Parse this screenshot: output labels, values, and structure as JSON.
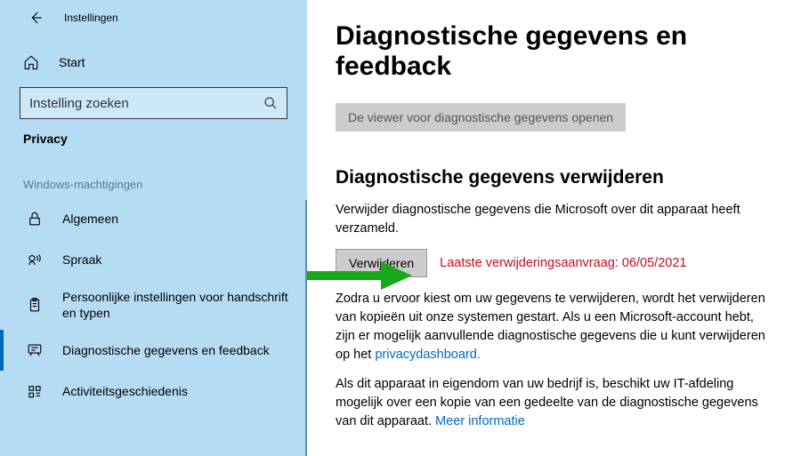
{
  "header": {
    "app_title": "Instellingen"
  },
  "sidebar": {
    "home_label": "Start",
    "search_placeholder": "Instelling zoeken",
    "current_category": "Privacy",
    "section_header": "Windows-machtigingen",
    "items": [
      {
        "label": "Algemeen"
      },
      {
        "label": "Spraak"
      },
      {
        "label": "Persoonlijke instellingen voor handschrift en typen"
      },
      {
        "label": "Diagnostische gegevens en feedback"
      },
      {
        "label": "Activiteitsgeschiedenis"
      }
    ]
  },
  "main": {
    "title": "Diagnostische gegevens en feedback",
    "viewer_button": "De viewer voor diagnostische gegevens openen",
    "delete_section_title": "Diagnostische gegevens verwijderen",
    "delete_intro": "Verwijder diagnostische gegevens die Microsoft over dit apparaat heeft verzameld.",
    "delete_button": "Verwijderen",
    "last_request": "Laatste verwijderingsaanvraag: 06/05/2021",
    "para1_pre": "Zodra u ervoor kiest om uw gegevens te verwijderen, wordt het verwijderen van kopieën uit onze systemen gestart. Als u een Microsoft-account hebt, zijn er mogelijk aanvullende diagnostische gegevens die u kunt verwijderen op het ",
    "para1_link": "privacydashboard.",
    "para2_pre": "Als dit apparaat in eigendom van uw bedrijf is, beschikt uw IT-afdeling mogelijk over een kopie van een gedeelte van de diagnostische gegevens van dit apparaat. ",
    "para2_link": "Meer informatie"
  }
}
